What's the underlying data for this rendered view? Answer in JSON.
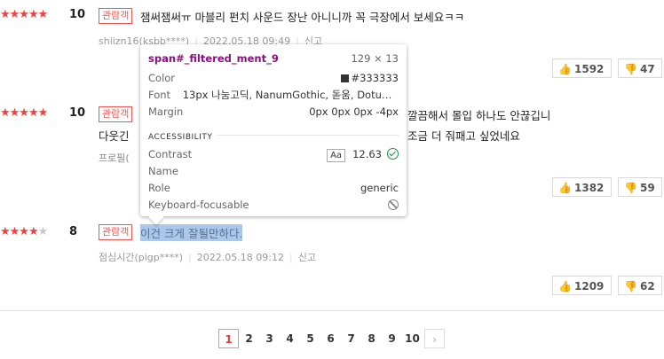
{
  "reviews": [
    {
      "stars": "★★★★★",
      "stars_off": "",
      "score": "10",
      "badge": "관람객",
      "text": "잼써잼써ㅠ 마블리 펀치 사운드 장난 아니니까 꼭 극장에서 보세요ㅋㅋ",
      "user": "shiizn16(ksbb****)",
      "date": "2022.05.18 09:49",
      "report": "신고",
      "like": "1592",
      "dislike": "47"
    },
    {
      "stars": "★★★★★",
      "stars_off": "",
      "score": "10",
      "badge": "관람객",
      "text_partial_right": "깔끔해서 몰입 하나도 안끊깁니",
      "text_line2_left": "다웃긴 ",
      "text_line2_right": "조금 더 줘패고 싶었네요",
      "user_partial": "프로필(",
      "like": "1382",
      "dislike": "59"
    },
    {
      "stars": "★★★★",
      "stars_off": "★",
      "score": "8",
      "badge": "관람객",
      "text": "이건 크게 잘될만하다.",
      "user": "점심시간(pigp****)",
      "date": "2022.05.18 09:12",
      "report": "신고",
      "like": "1209",
      "dislike": "62"
    }
  ],
  "pagination": {
    "pages": [
      "1",
      "2",
      "3",
      "4",
      "5",
      "6",
      "7",
      "8",
      "9",
      "10"
    ],
    "current": "1",
    "next": "›"
  },
  "tooltip": {
    "selector": "span#_filtered_ment_9",
    "size": "129 × 13",
    "color_label": "Color",
    "color_value": "#333333",
    "font_label": "Font",
    "font_value": "13px 나눔고딕, NanumGothic, 돋움, Dotu…",
    "margin_label": "Margin",
    "margin_value": "0px 0px 0px -4px",
    "section": "ACCESSIBILITY",
    "contrast_label": "Contrast",
    "contrast_aa": "Aa",
    "contrast_value": "12.63",
    "name_label": "Name",
    "role_label": "Role",
    "role_value": "generic",
    "focus_label": "Keyboard-focusable"
  },
  "colors": {
    "star": "#f43f3f",
    "badge": "#f4564d",
    "highlight": "#a9c8ec",
    "selector": "#881280"
  }
}
